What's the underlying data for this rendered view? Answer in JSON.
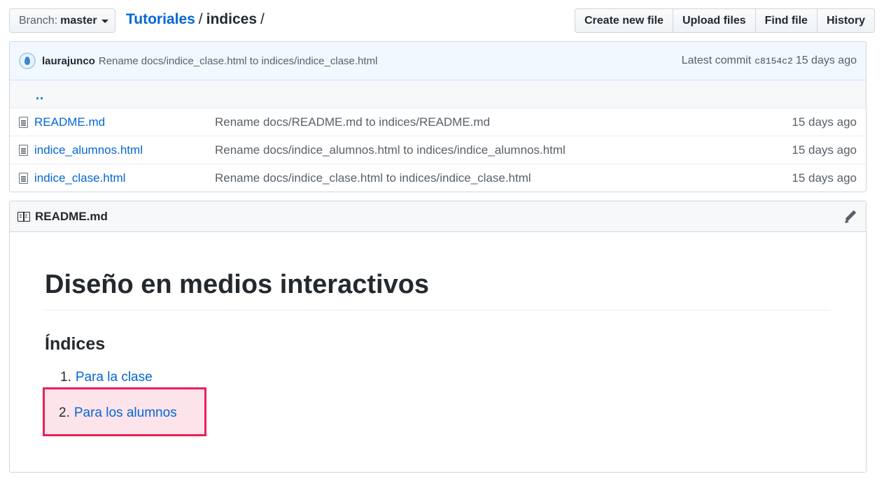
{
  "branch": {
    "label": "Branch:",
    "value": "master"
  },
  "breadcrumb": {
    "repo": "Tutoriales",
    "sep1": "/",
    "dir": "indices",
    "sep2": "/"
  },
  "file_nav": {
    "create_new_file": "Create new file",
    "upload_files": "Upload files",
    "find_file": "Find file",
    "history": "History"
  },
  "commit": {
    "author": "laurajunco",
    "message": "Rename docs/indice_clase.html to indices/indice_clase.html",
    "latest_label": "Latest commit",
    "sha": "c8154c2",
    "age": "15 days ago"
  },
  "parent_dir": "..",
  "files": [
    {
      "name": "README.md",
      "message": "Rename docs/README.md to indices/README.md",
      "age": "15 days ago"
    },
    {
      "name": "indice_alumnos.html",
      "message": "Rename docs/indice_alumnos.html to indices/indice_alumnos.html",
      "age": "15 days ago"
    },
    {
      "name": "indice_clase.html",
      "message": "Rename docs/indice_clase.html to indices/indice_clase.html",
      "age": "15 days ago"
    }
  ],
  "readme": {
    "filename": "README.md",
    "h1": "Diseño en medios interactivos",
    "h2": "Índices",
    "items": [
      {
        "num": "1.",
        "label": "Para la clase"
      },
      {
        "num": "2.",
        "label": "Para los alumnos"
      }
    ]
  },
  "colors": {
    "link": "#0366d6",
    "highlight_border": "#e8215b",
    "highlight_fill": "#fde4ea"
  },
  "icons": [
    "caret-down-icon",
    "avatar-icon",
    "file-icon",
    "book-icon",
    "pencil-icon"
  ]
}
